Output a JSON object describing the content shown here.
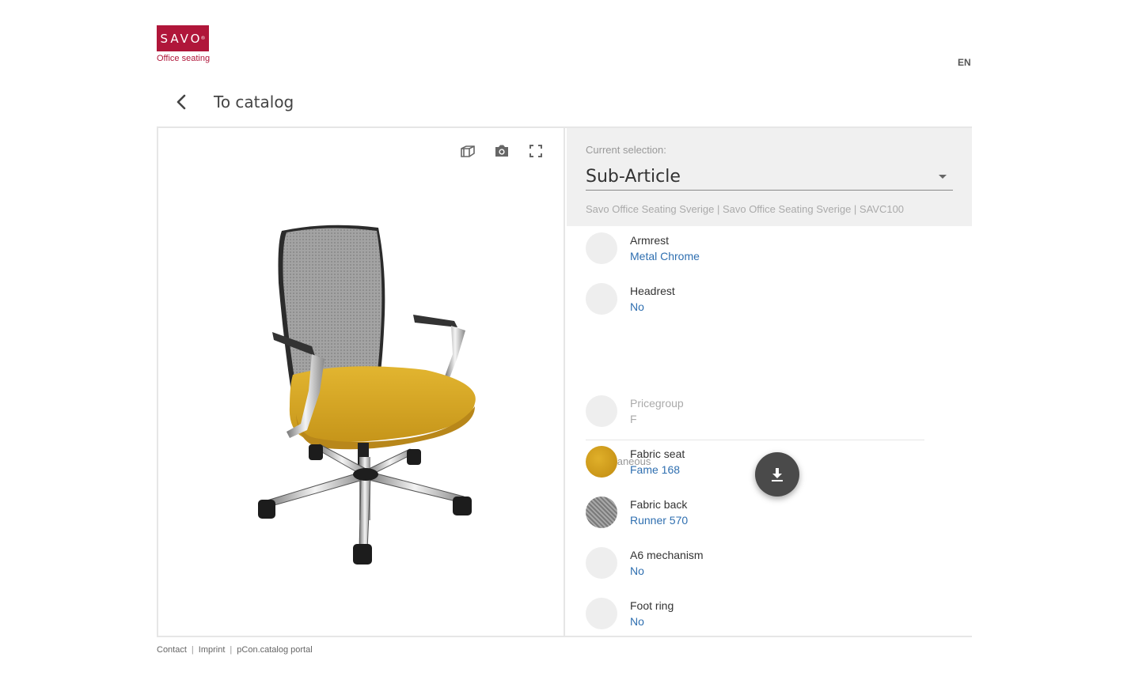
{
  "brand": {
    "logo_text": "SAVO",
    "tagline": "Office seating",
    "accent": "#b0163a"
  },
  "header": {
    "language": "EN",
    "back_label": "To catalog"
  },
  "viewer": {
    "tools": [
      {
        "icon": "3d-cube-icon"
      },
      {
        "icon": "camera-icon"
      },
      {
        "icon": "fullscreen-icon"
      }
    ]
  },
  "selection": {
    "label": "Current selection:",
    "value": "Sub-Article",
    "breadcrumb": "Savo Office Seating Sverige | Savo Office Seating Sverige | SAVC100"
  },
  "options": [
    {
      "name": "Armrest",
      "value": "Metal Chrome"
    },
    {
      "name": "Headrest",
      "value": "No"
    }
  ],
  "misc": {
    "title": "Miscellaneous",
    "items": [
      {
        "name": "Pricegroup",
        "value": "F",
        "disabled": true
      },
      {
        "name": "Fabric seat",
        "value": "Fame 168",
        "swatch_color": "#d4a017"
      },
      {
        "name": "Fabric back",
        "value": "Runner 570",
        "swatch_color": "#8a8a8a"
      },
      {
        "name": "A6 mechanism",
        "value": "No"
      },
      {
        "name": "Foot ring",
        "value": "No"
      }
    ]
  },
  "footer": {
    "links": [
      "Contact",
      "Imprint",
      "pCon.catalog portal"
    ],
    "separator": "|"
  },
  "colors": {
    "link": "#2f6fb0",
    "panel_bg": "#f0f0f0",
    "seat": "#d8a724",
    "back_mesh": "#9a9a9a"
  }
}
